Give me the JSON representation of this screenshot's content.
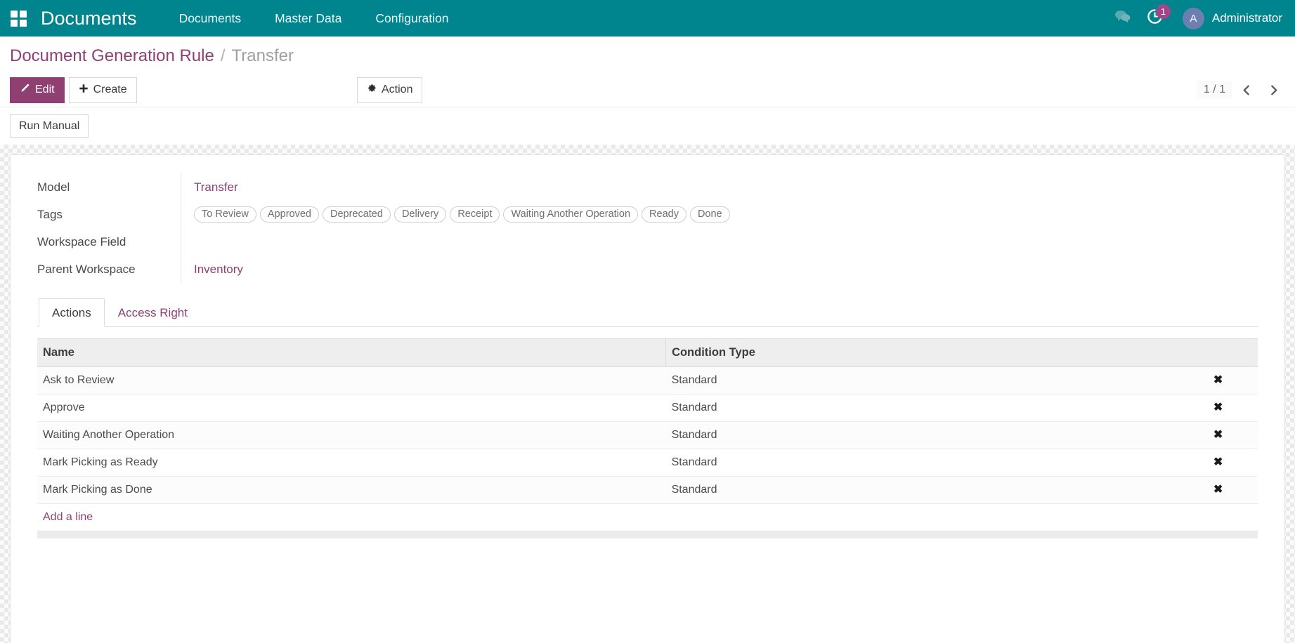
{
  "navbar": {
    "apps_icon": "apps-grid-icon",
    "brand": "Documents",
    "menu_items": [
      {
        "label": "Documents"
      },
      {
        "label": "Master Data"
      },
      {
        "label": "Configuration"
      }
    ],
    "messages_icon": "chat-bubbles-icon",
    "activities_icon": "clock-icon",
    "activity_badge": "1",
    "avatar_initial": "A",
    "user_name": "Administrator",
    "bg_color": "#00848e"
  },
  "breadcrumb": {
    "root": "Document Generation Rule",
    "separator": "/",
    "current": "Transfer"
  },
  "control_panel": {
    "edit_label": "Edit",
    "edit_icon": "pencil-icon",
    "create_label": "Create",
    "create_icon": "plus-icon",
    "action_label": "Action",
    "action_icon": "gear-icon",
    "pager_value": "1 / 1",
    "prev_icon": "chevron-left-icon",
    "next_icon": "chevron-right-icon"
  },
  "statusbar": {
    "run_manual_label": "Run Manual"
  },
  "form": {
    "fields": [
      {
        "label": "Model",
        "value": "Transfer",
        "type": "link"
      },
      {
        "label": "Tags",
        "value": "",
        "type": "tags"
      },
      {
        "label": "Workspace Field",
        "value": "",
        "type": "text"
      },
      {
        "label": "Parent Workspace",
        "value": "Inventory",
        "type": "link"
      }
    ],
    "tags": [
      "To Review",
      "Approved",
      "Deprecated",
      "Delivery",
      "Receipt",
      "Waiting Another Operation",
      "Ready",
      "Done"
    ]
  },
  "notebook": {
    "tabs": [
      {
        "label": "Actions",
        "active": true
      },
      {
        "label": "Access Right",
        "active": false
      }
    ],
    "table": {
      "columns": [
        "Name",
        "Condition Type",
        ""
      ],
      "rows": [
        {
          "name": "Ask to Review",
          "condition_type": "Standard",
          "delete_icon": "close-x-icon"
        },
        {
          "name": "Approve",
          "condition_type": "Standard",
          "delete_icon": "close-x-icon"
        },
        {
          "name": "Waiting Another Operation",
          "condition_type": "Standard",
          "delete_icon": "close-x-icon"
        },
        {
          "name": "Mark Picking as Ready",
          "condition_type": "Standard",
          "delete_icon": "close-x-icon"
        },
        {
          "name": "Mark Picking as Done",
          "condition_type": "Standard",
          "delete_icon": "close-x-icon"
        }
      ],
      "add_line_label": "Add a line"
    }
  },
  "colors": {
    "brand_teal": "#00848e",
    "accent_purple": "#8f3f72",
    "badge_magenta": "#a24689",
    "avatar_blue": "#6d7eb0"
  }
}
